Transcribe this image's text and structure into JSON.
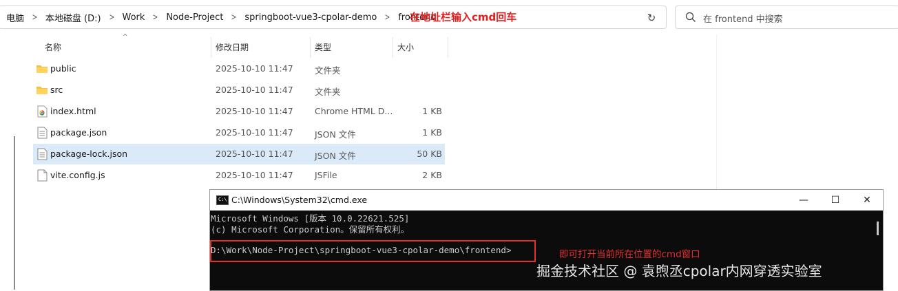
{
  "address_bar": {
    "breadcrumbs": [
      "电脑",
      "本地磁盘 (D:)",
      "Work",
      "Node-Project",
      "springboot-vue3-cpolar-demo",
      "frontend"
    ],
    "annotation": "在地址栏输入cmd回车"
  },
  "search": {
    "placeholder": "在 frontend 中搜索"
  },
  "columns": {
    "name": "名称",
    "date": "修改日期",
    "type": "类型",
    "size": "大小"
  },
  "files": [
    {
      "name": "public",
      "date": "2025-10-10 11:47",
      "type": "文件夹",
      "size": "",
      "icon": "folder-icon"
    },
    {
      "name": "src",
      "date": "2025-10-10 11:47",
      "type": "文件夹",
      "size": "",
      "icon": "folder-icon"
    },
    {
      "name": "index.html",
      "date": "2025-10-10 11:47",
      "type": "Chrome HTML D...",
      "size": "1 KB",
      "icon": "chrome-file-icon"
    },
    {
      "name": "package.json",
      "date": "2025-10-10 11:47",
      "type": "JSON 文件",
      "size": "1 KB",
      "icon": "document-icon"
    },
    {
      "name": "package-lock.json",
      "date": "2025-10-10 11:47",
      "type": "JSON 文件",
      "size": "50 KB",
      "icon": "document-icon",
      "selected": true
    },
    {
      "name": "vite.config.js",
      "date": "2025-10-10 11:47",
      "type": "JSFile",
      "size": "2 KB",
      "icon": "blank-file-icon"
    }
  ],
  "cmd": {
    "title": "C:\\Windows\\System32\\cmd.exe",
    "lines": [
      "Microsoft Windows [版本 10.0.22621.525]",
      "(c) Microsoft Corporation。保留所有权利。"
    ],
    "prompt": "D:\\Work\\Node-Project\\springboot-vue3-cpolar-demo\\frontend>",
    "annotation": "即可打开当前所在位置的cmd窗口",
    "icon_text": "C:\\"
  },
  "watermark": "掘金技术社区 @ 袁煦丞cpolar内网穿透实验室",
  "colors": {
    "annotation_red": "#e53030",
    "selection": "#dbeaf8",
    "folder": "#f4c244"
  }
}
